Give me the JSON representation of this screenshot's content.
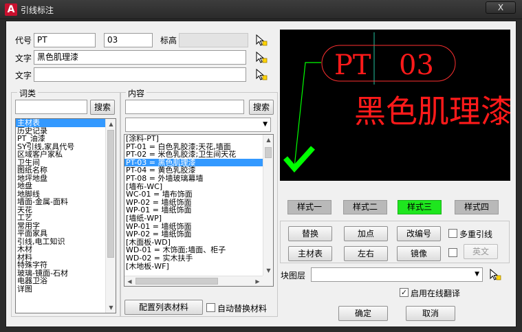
{
  "window": {
    "app_icon_letter": "A",
    "title": "引线标注",
    "close_label": "X"
  },
  "form": {
    "code_label": "代号",
    "code_value": "PT",
    "number_value": "03",
    "elevation_label": "标高",
    "elevation_value": "",
    "text1_label": "文字",
    "text1_value": "黑色肌理漆",
    "text2_label": "文字",
    "text2_value": ""
  },
  "category": {
    "title": "词类",
    "search_value": "",
    "search_button": "搜索",
    "items": [
      "主材表",
      "历史记录",
      "PT_油漆",
      "SY引线,家具代号",
      "区域客户家私",
      "卫生间",
      "图纸名称",
      "地坪地盘",
      "地盘",
      "地脚线",
      "墙面-金属-面料",
      "天花",
      "工艺",
      "常用字",
      "平面家具",
      "引线,电工知识",
      "木材",
      "材料",
      "特殊字符",
      "玻璃-镜面-石材",
      "电器卫浴",
      "详图"
    ],
    "selected_index": 0
  },
  "content": {
    "title": "内容",
    "search_value": "",
    "search_button": "搜索",
    "dropdown_value": "",
    "items": [
      "[涂料-PT]",
      "PT-01 = 白色乳胶漆;天花,墙面",
      "PT-02 = 米色乳胶漆;卫生间天花",
      "PT-03 = 黑色肌理漆",
      "PT-04 = 黄色乳胶漆",
      "PT-08 = 外墙玻璃幕墙",
      "[墙布-WC]",
      "WC-01 = 墙布饰面",
      "WP-02 = 墙纸饰面",
      "WP-01 = 墙纸饰面",
      "[墙纸-WP]",
      "WP-01 = 墙纸饰面",
      "WP-02 = 墙纸饰面",
      "[木面板-WD]",
      "WD-01 = 木饰面;墙面、柜子",
      "WD-02 = 实木扶手",
      "[木地板-WF]"
    ],
    "selected_index": 3,
    "config_button": "配置列表材料",
    "auto_replace_label": "自动替换材料",
    "auto_replace_checked": false
  },
  "preview": {
    "code": "PT",
    "number": "03",
    "text": "黑色肌理漆",
    "text_color": "#ff1a1a",
    "leader_color": "#00ff00"
  },
  "styles": {
    "items": [
      "样式一",
      "样式二",
      "样式三",
      "样式四"
    ],
    "active_index": 2,
    "active_color": "#1ee61e"
  },
  "actions": {
    "replace": "替换",
    "add_point": "加点",
    "renumber": "改编号",
    "multi_leader_label": "多重引线",
    "multi_leader_checked": false,
    "material_table": "主材表",
    "left_right": "左右",
    "mirror": "镜像",
    "english_checked": false,
    "english": "英文"
  },
  "layer": {
    "label": "块图层",
    "value": ""
  },
  "translate": {
    "label": "启用在线翻译",
    "checked": true
  },
  "footer": {
    "ok": "确定",
    "cancel": "取消"
  }
}
